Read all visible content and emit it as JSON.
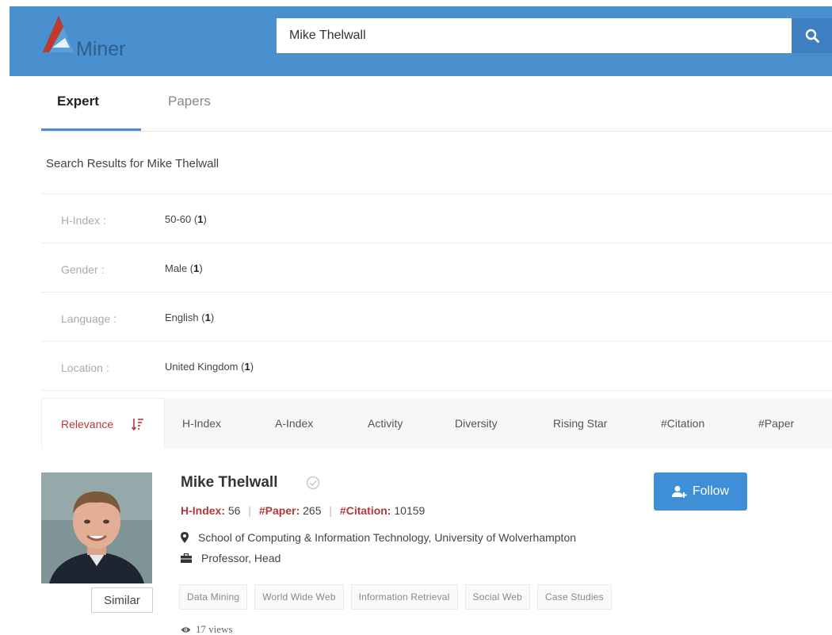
{
  "header": {
    "logo_text": "Miner",
    "search_value": "Mike Thelwall"
  },
  "tabs": [
    {
      "label": "Expert",
      "active": true
    },
    {
      "label": "Papers",
      "active": false
    }
  ],
  "results_title": "Search Results for  Mike Thelwall",
  "filters": [
    {
      "label": "H-Index :",
      "value": "50-60 (",
      "count": "1",
      "close": ")"
    },
    {
      "label": "Gender :",
      "value": "Male (",
      "count": "1",
      "close": ")"
    },
    {
      "label": "Language :",
      "value": "English (",
      "count": "1",
      "close": ")"
    },
    {
      "label": "Location :",
      "value": "United Kingdom (",
      "count": "1",
      "close": ")"
    }
  ],
  "sort": {
    "active": "Relevance",
    "options": [
      "H-Index",
      "A-Index",
      "Activity",
      "Diversity",
      "Rising Star",
      "#Citation",
      "#Paper"
    ]
  },
  "result": {
    "name": "Mike Thelwall",
    "h_index_label": "H-Index:",
    "h_index": "56",
    "paper_label": "#Paper:",
    "paper": "265",
    "citation_label": "#Citation:",
    "citation": "10159",
    "affiliation": "School of Computing & Information Technology, University of Wolverhampton",
    "position": "Professor, Head",
    "follow_label": "Follow",
    "similar_label": "Similar",
    "tags": [
      "Data Mining",
      "World Wide Web",
      "Information Retrieval",
      "Social Web",
      "Case Studies"
    ],
    "views": "17 views"
  },
  "colors": {
    "header_bg": "#4a8fce",
    "accent_red": "#b03a3a",
    "follow_bg": "#3e8fd6"
  }
}
